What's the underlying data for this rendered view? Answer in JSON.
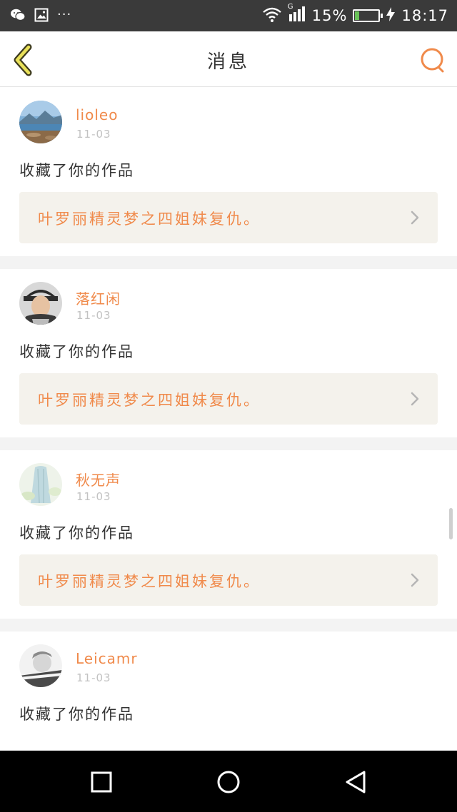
{
  "status_bar": {
    "icons": [
      "wechat-icon",
      "image-icon",
      "more-dots-icon",
      "wifi-icon",
      "signal-icon",
      "battery-icon",
      "charging-icon"
    ],
    "dots": "···",
    "network": "G",
    "battery_percent": "15%",
    "battery_level": 0.15,
    "battery_color": "#6ac259",
    "time": "18:17"
  },
  "header": {
    "title": "消息",
    "back_icon": "chevron-left-icon",
    "search_icon": "search-icon",
    "accent_color": "#f08a4b"
  },
  "messages": [
    {
      "username": "lioleo",
      "time": "11-03",
      "text": "收藏了你的作品",
      "work_title": "叶罗丽精灵梦之四姐妹复仇。"
    },
    {
      "username": "落红闲",
      "time": "11-03",
      "text": "收藏了你的作品",
      "work_title": "叶罗丽精灵梦之四姐妹复仇。"
    },
    {
      "username": "秋无声",
      "time": "11-03",
      "text": "收藏了你的作品",
      "work_title": "叶罗丽精灵梦之四姐妹复仇。"
    },
    {
      "username": "Leicamr",
      "time": "11-03",
      "text": "收藏了你的作品",
      "work_title": ""
    }
  ],
  "nav_bar": {
    "icons": [
      "recent-apps-icon",
      "home-icon",
      "back-icon"
    ]
  }
}
